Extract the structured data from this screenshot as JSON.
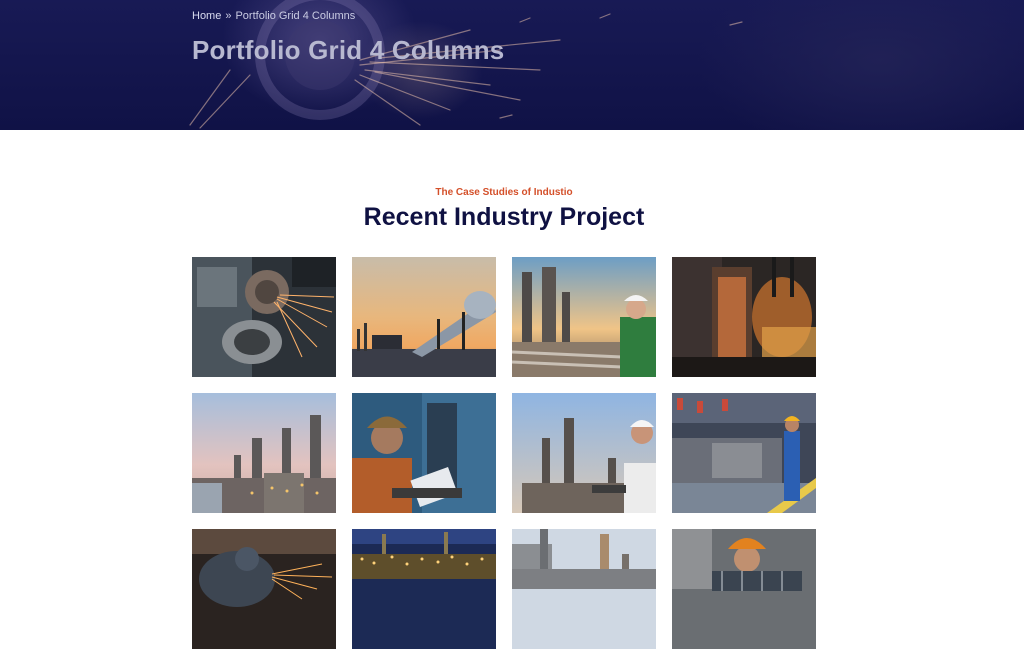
{
  "hero": {
    "breadcrumb": {
      "home": "Home",
      "separator": "»",
      "current": "Portfolio Grid 4 Columns"
    },
    "title": "Portfolio Grid 4 Columns"
  },
  "section": {
    "eyebrow": "The Case Studies of Industio",
    "title": "Recent Industry Project"
  },
  "colors": {
    "hero_bg": "#141650",
    "title_dark": "#0f1142",
    "accent": "#d4502a"
  },
  "portfolio": [
    {
      "subject": "grinding-sparks-workshop"
    },
    {
      "subject": "pipeline-sunset-refinery"
    },
    {
      "subject": "engineer-refinery-sunset"
    },
    {
      "subject": "foundry-furnace"
    },
    {
      "subject": "refinery-dusk-towers"
    },
    {
      "subject": "worker-with-laptop-plant"
    },
    {
      "subject": "engineer-refinery-blue-sky"
    },
    {
      "subject": "worker-steel-mill"
    },
    {
      "subject": "welder-sparks"
    },
    {
      "subject": "refinery-night-lights"
    },
    {
      "subject": "refinery-columns-daylight"
    },
    {
      "subject": "worker-orange-helmet"
    }
  ]
}
